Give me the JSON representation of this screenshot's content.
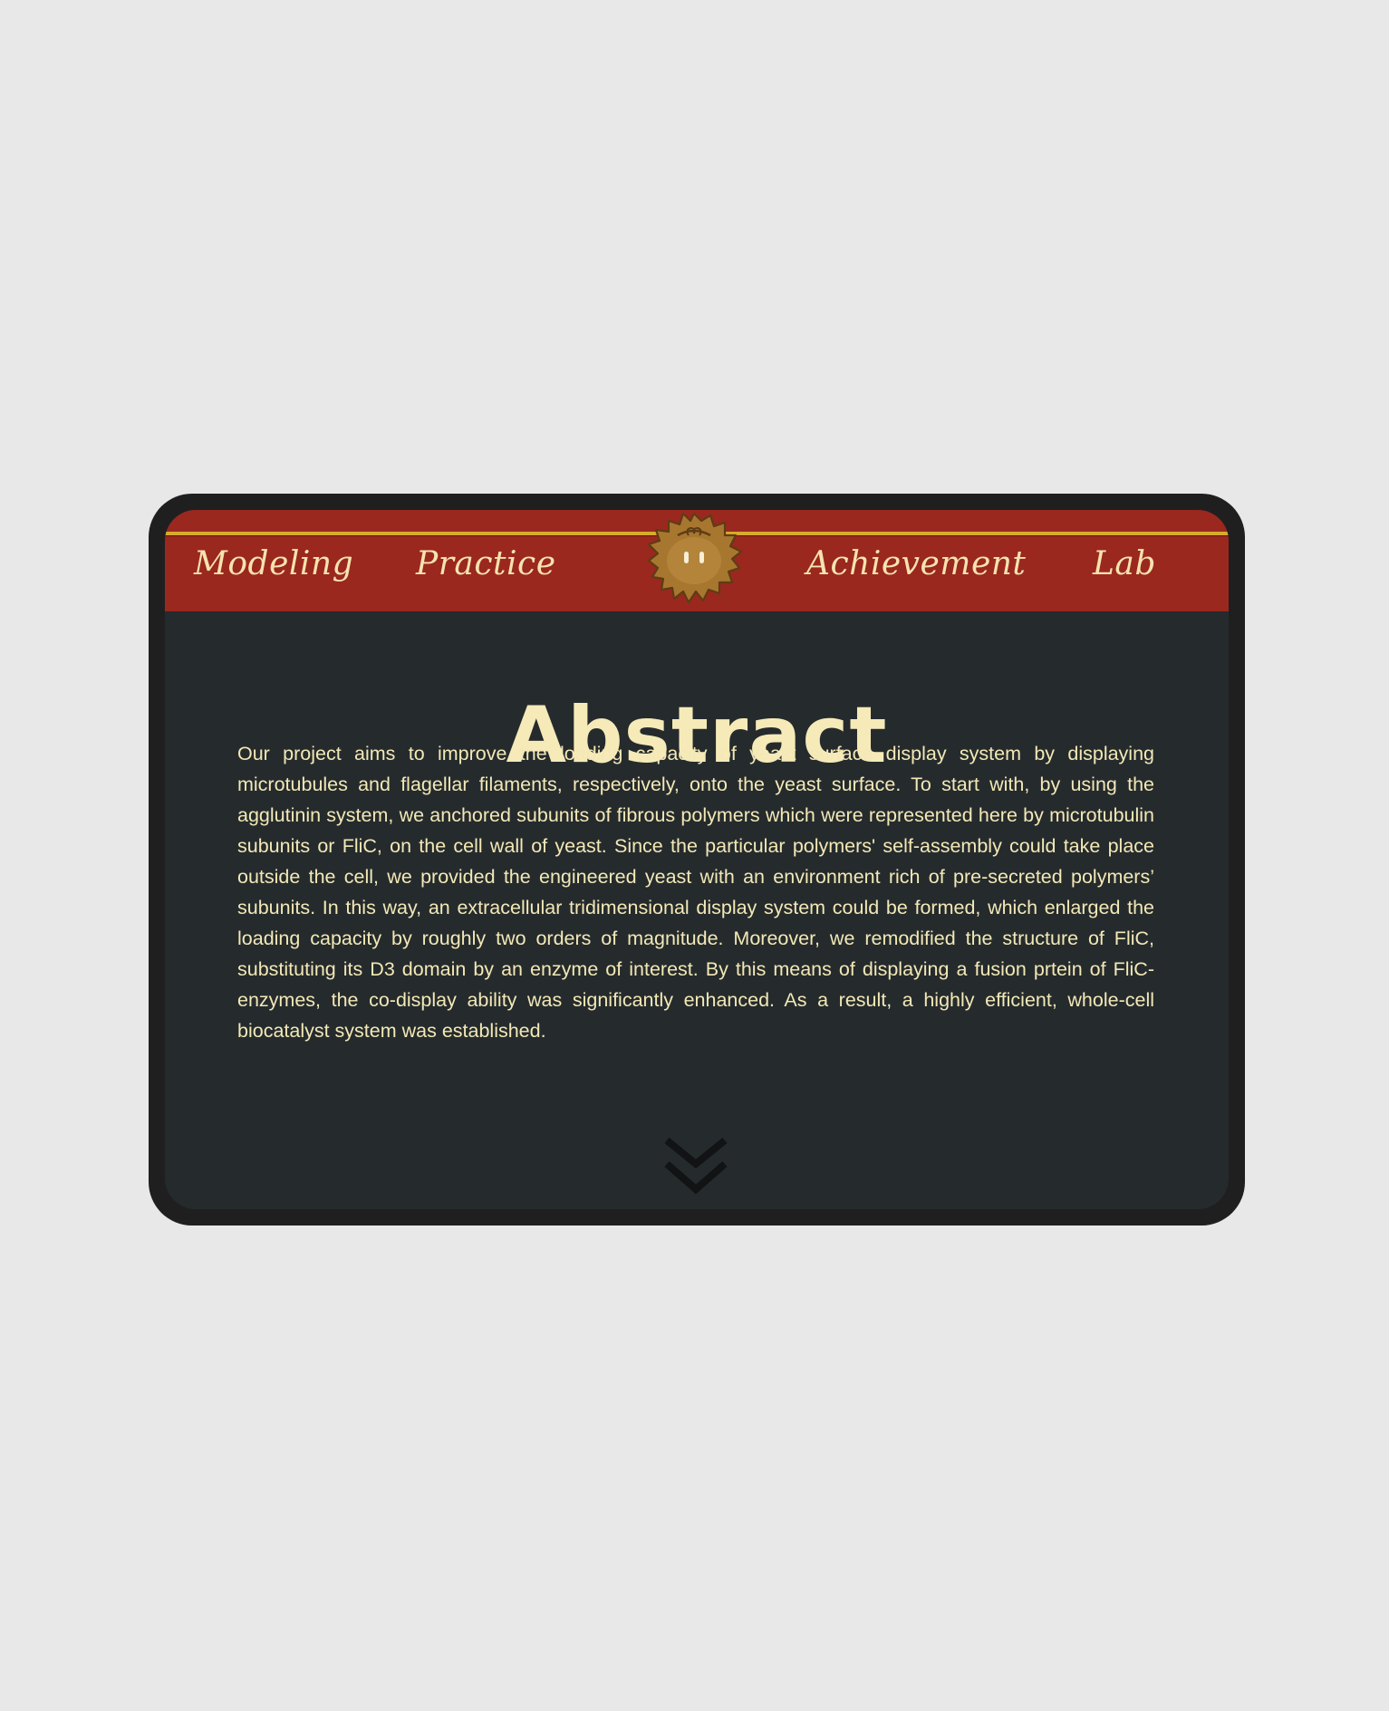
{
  "nav": {
    "items": [
      {
        "label": "Modeling"
      },
      {
        "label": "Practice"
      },
      {
        "label": "Achievement"
      },
      {
        "label": "Lab"
      }
    ],
    "logo_icon": "lion-mascot-icon"
  },
  "main": {
    "title": "Abstract",
    "body": "Our project aims to improve the loading capacity of yeast surface display system by displaying microtubules and flagellar filaments, respectively, onto the yeast surface. To start with, by using the agglutinin system, we anchored subunits of fibrous polymers which were represented here by microtubulin subunits or FliC, on the cell wall of yeast. Since the particular polymers' self-assembly could take place outside the cell, we provided the engineered yeast with an environment rich of pre-secreted polymers’ subunits. In this way, an extracellular tridimensional display system could be formed, which enlarged the loading capacity by roughly two orders of magnitude. Moreover, we remodified the structure of FliC, substituting its D3 domain by an enzyme of interest. By this means of displaying a fusion prtein of FliC-enzymes, the co-display ability was significantly enhanced. As a result, a highly efficient, whole-cell biocatalyst system was established.",
    "scroll_icon": "double-chevron-down-icon"
  },
  "colors": {
    "page_background": "#e8e8e8",
    "device_frame": "#1f1f20",
    "screen_background": "#252b2d",
    "navbar_red": "#9a281f",
    "gold_stripe": "#d6ac2c",
    "cream_text": "#f5eab8"
  }
}
